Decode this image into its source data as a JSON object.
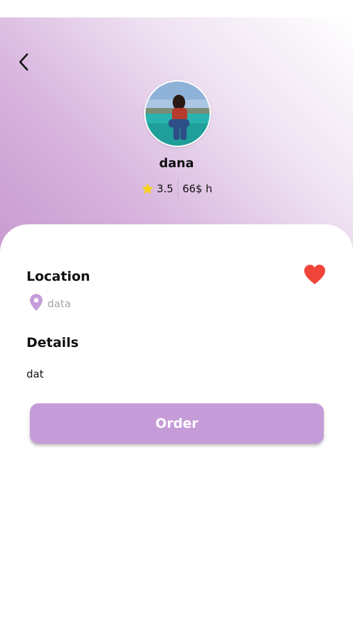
{
  "profile": {
    "name": "dana",
    "rating": "3.5",
    "price": "66$ h"
  },
  "location": {
    "title": "Location",
    "value": "data"
  },
  "details": {
    "title": "Details",
    "value": "dat"
  },
  "actions": {
    "order_label": "Order"
  },
  "icons": {
    "back": "chevron-left-icon",
    "star": "star-icon",
    "heart": "heart-icon",
    "pin": "map-pin-icon"
  },
  "colors": {
    "accent": "#c59cd8",
    "heart": "#f04438",
    "star": "#f7d21c",
    "pin": "#c59cd8"
  }
}
